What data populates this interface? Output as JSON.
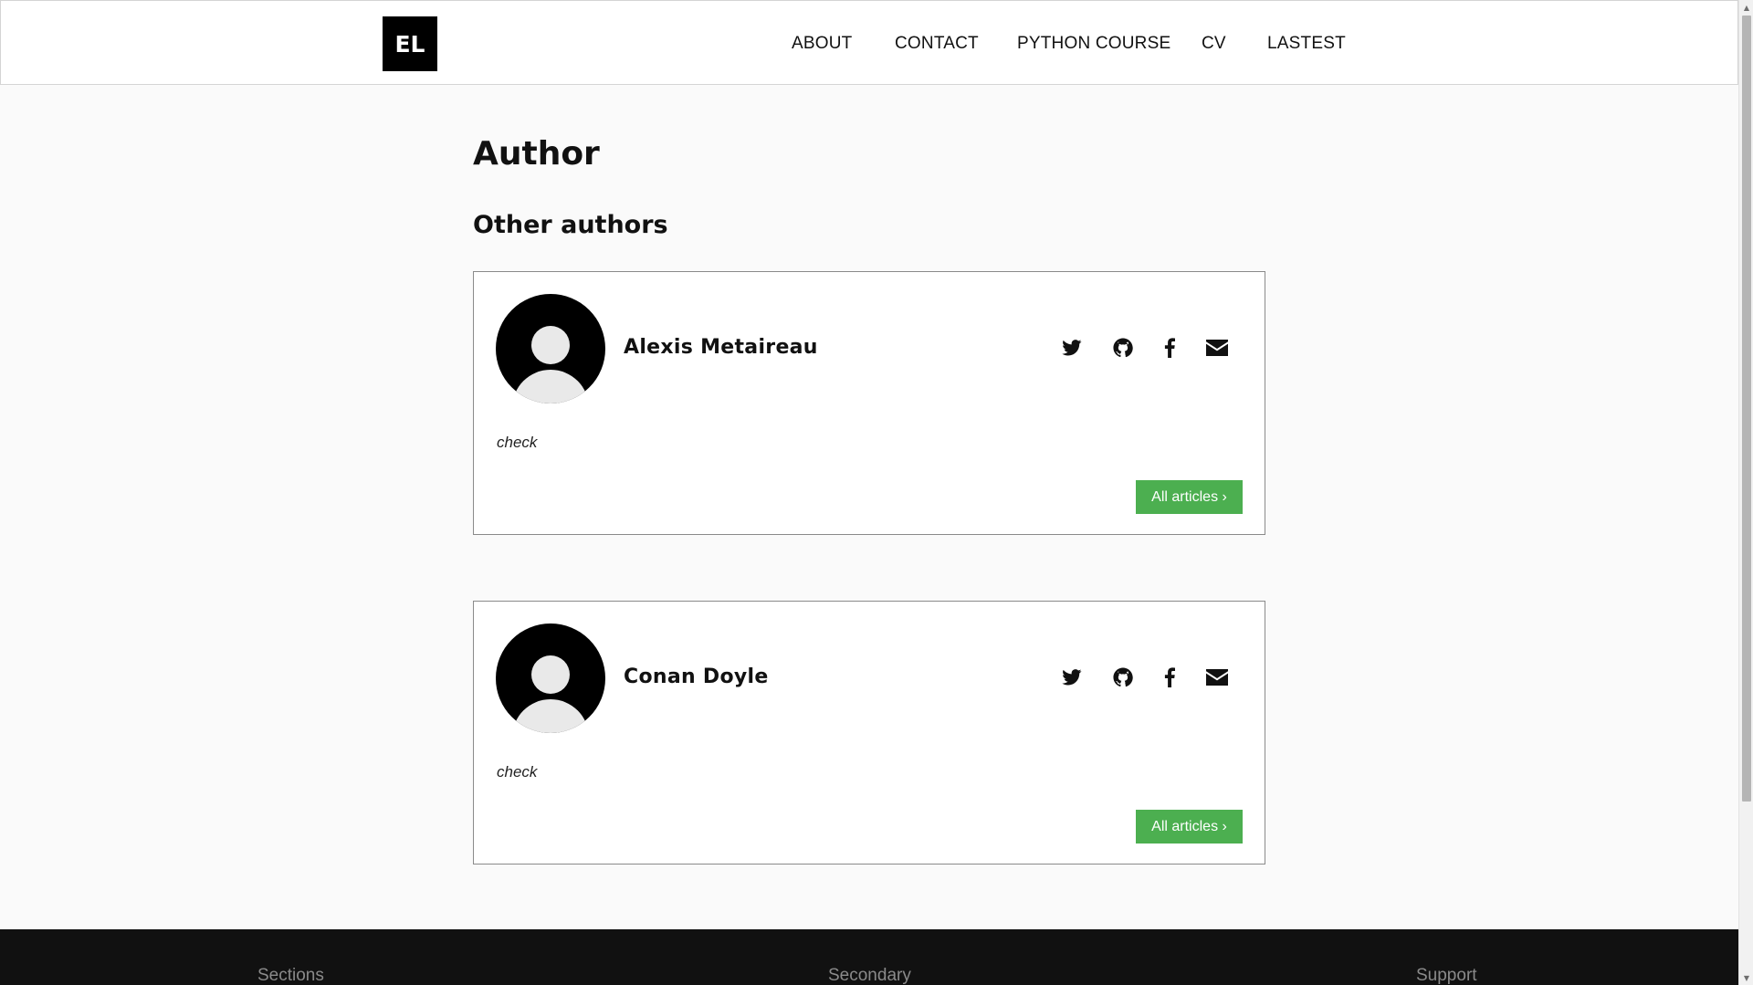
{
  "header": {
    "logo": "EL",
    "nav": [
      "ABOUT",
      "CONTACT",
      "PYTHON COURSE",
      "CV",
      "LASTEST"
    ]
  },
  "main": {
    "title": "Author",
    "section_title": "Other authors",
    "authors": [
      {
        "name": "Alexis Metaireau",
        "bio": "check",
        "button_label": "All articles ›"
      },
      {
        "name": "Conan Doyle",
        "bio": "check",
        "button_label": "All articles ›"
      }
    ],
    "social_icons": [
      "twitter-icon",
      "github-icon",
      "facebook-icon",
      "envelope-icon"
    ]
  },
  "footer": {
    "columns": [
      "Sections",
      "Secondary",
      "Support"
    ]
  },
  "colors": {
    "accent": "#4caf50",
    "logo_bg": "#000000",
    "footer_bg": "#111111"
  }
}
